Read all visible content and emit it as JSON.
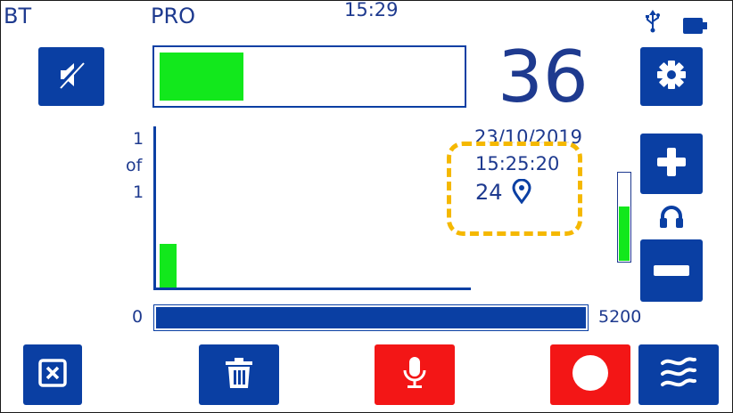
{
  "status_bar": {
    "bt_label": "BT",
    "mode_label": "PRO",
    "clock": "15:29",
    "usb_icon": "usb-icon",
    "battery_icon": "battery-icon"
  },
  "signal": {
    "level_fraction": 0.28,
    "reading": "36"
  },
  "chart": {
    "page_current": "1",
    "page_of": "of",
    "page_total": "1",
    "bar_fraction": 0.27,
    "date": "23/10/2019",
    "time": "15:25:20",
    "location_count": "24",
    "location_icon": "map-pin-icon"
  },
  "volume": {
    "level_fraction": 0.62,
    "icon": "headphones-icon"
  },
  "range": {
    "min": "0",
    "max": "5200",
    "fill_fraction": 1.0
  },
  "buttons": {
    "mute": "speaker-mute-icon",
    "settings": "gear-icon",
    "plus": "plus-icon",
    "minus": "minus-icon",
    "close": "close-box-icon",
    "delete": "trash-icon",
    "mic": "microphone-icon",
    "record": "record-icon",
    "waves": "waves-icon"
  },
  "colors": {
    "primary_blue": "#0a3fa3",
    "signal_green": "#12e81c",
    "highlight_orange": "#f5b800",
    "record_red": "#f31616"
  }
}
